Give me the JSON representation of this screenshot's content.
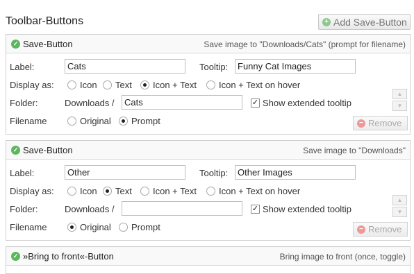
{
  "page_title": "Toolbar-Buttons",
  "add_button_label": "Add Save-Button",
  "common": {
    "label_label": "Label:",
    "tooltip_label": "Tooltip:",
    "display_label": "Display as:",
    "folder_label": "Folder:",
    "folder_prefix": "Downloads /",
    "filename_label": "Filename",
    "display_options": [
      "Icon",
      "Text",
      "Icon + Text",
      "Icon + Text on hover"
    ],
    "filename_options": [
      "Original",
      "Prompt"
    ],
    "show_tooltip_label": "Show extended tooltip",
    "remove_label": "Remove"
  },
  "panels": [
    {
      "title": "Save-Button",
      "description": "Save image to \"Downloads/Cats\" (prompt for filename)",
      "label_value": "Cats",
      "tooltip_value": "Funny Cat Images",
      "display_selected": "Icon + Text",
      "folder_value": "Cats",
      "show_extended_tooltip": true,
      "filename_selected": "Prompt"
    },
    {
      "title": "Save-Button",
      "description": "Save image to \"Downloads\"",
      "label_value": "Other",
      "tooltip_value": "Other Images",
      "display_selected": "Text",
      "folder_value": "",
      "show_extended_tooltip": true,
      "filename_selected": "Original"
    },
    {
      "title": "»Bring to front«-Button",
      "description": "Bring image to front (once, toggle)"
    }
  ],
  "icons": {
    "add": "plus-circle-icon",
    "enabled": "check-circle-icon",
    "remove": "minus-circle-icon",
    "move_up": "arrow-up-icon",
    "move_down": "arrow-down-icon"
  },
  "colors": {
    "check_green": "#5cb85c",
    "remove_red": "#e99999",
    "border": "#cfcfcf"
  }
}
